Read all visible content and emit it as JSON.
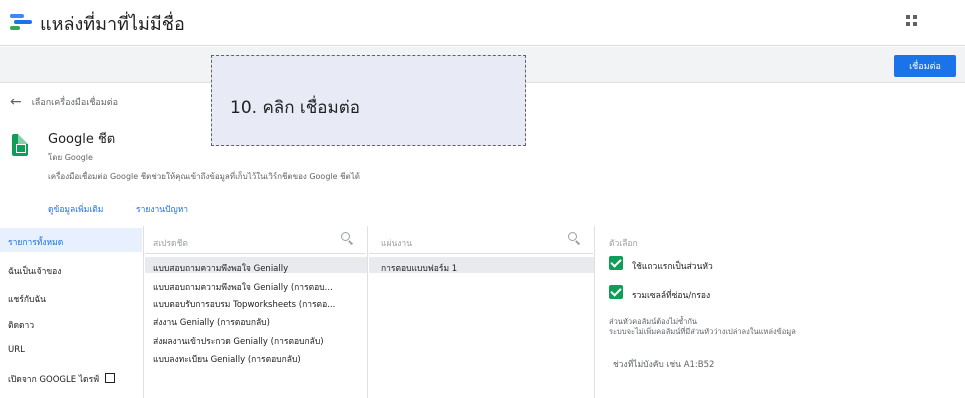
{
  "header": {
    "title": "แหล่งที่มาที่ไม่มีชื่อ",
    "connect_label": "เชื่อมต่อ",
    "logo_colors": [
      "#4285f4",
      "#34a853",
      "#1a73e8"
    ]
  },
  "back": {
    "label": "เลือกเครื่องมือเชื่อมต่อ"
  },
  "connector": {
    "name": "Google ชีต",
    "by": "โดย Google",
    "description": "เครื่องมือเชื่อมต่อ Google ชีตช่วยให้คุณเข้าถึงข้อมูลที่เก็บไว้ในเวิร์กชีตของ Google ชีตได้",
    "learn_more": "ดูข้อมูลเพิ่มเติม",
    "report_issue": "รายงานปัญหา"
  },
  "callout": {
    "text": "10. คลิก เชื่อมต่อ"
  },
  "sidebar": {
    "items": [
      {
        "label": "รายการทั้งหมด",
        "active": true
      },
      {
        "label": "ฉันเป็นเจ้าของ"
      },
      {
        "label": "แชร์กับฉัน"
      },
      {
        "label": "ติดดาว"
      },
      {
        "label": "URL"
      },
      {
        "label": "เปิดจาก GOOGLE ไดรฟ์"
      }
    ]
  },
  "spreadsheets": {
    "header": "สเปรดชีต",
    "items": [
      "แบบสอบถามความพึงพอใจ Genially",
      "แบบสอบถามความพึงพอใจ Genially (การตอบ...",
      "แบบตอบรับการอบรม Topworksheets (การตอ...",
      "ส่งงาน Genially (การตอบกลับ)",
      "ส่งผลงานเข้าประกวด Genially (การตอบกลับ)",
      "แบบลงทะเบียน Genially (การตอบกลับ)"
    ]
  },
  "worksheets": {
    "header": "แผ่นงาน",
    "items": [
      "การตอบแบบฟอร์ม 1"
    ]
  },
  "options": {
    "header": "ตัวเลือก",
    "checkbox1": "ใช้แถวแรกเป็นส่วนหัว",
    "checkbox2": "รวมเซลล์ที่ซ่อน/กรอง",
    "note_line1": "ส่วนหัวคอลัมน์ต้องไม่ซ้ำกัน",
    "note_line2": "ระบบจะไม่เพิ่มคอลัมน์ที่มีส่วนหัวว่างเปล่าลงในแหล่งข้อมูล",
    "range_placeholder": "ช่วงที่ไม่บังคับ เช่น A1:B52"
  }
}
